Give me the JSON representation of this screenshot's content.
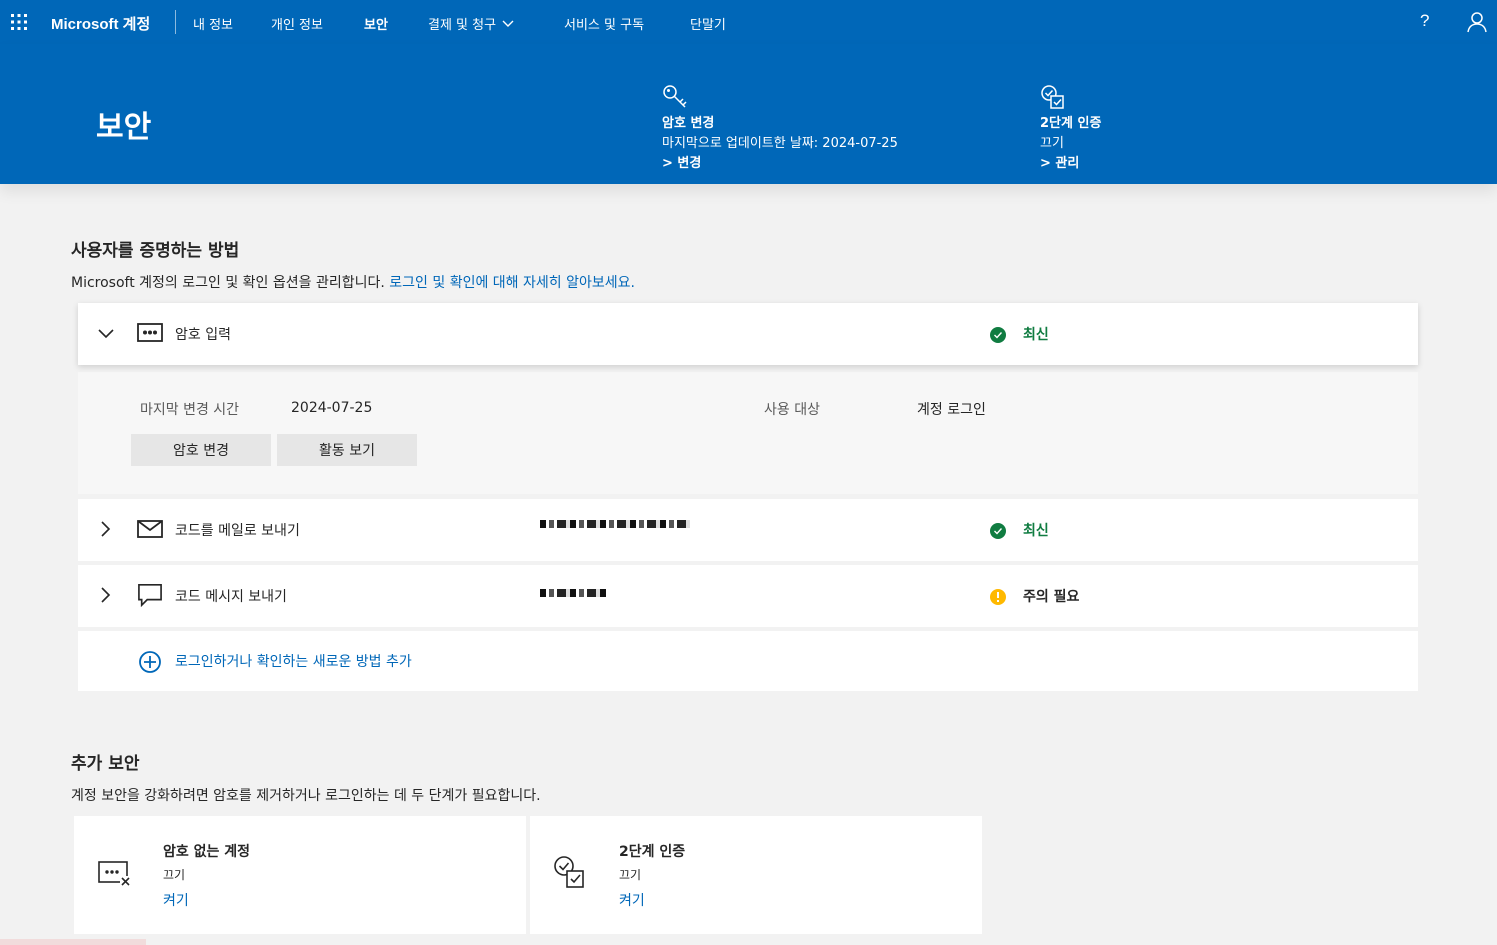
{
  "nav": {
    "brand": "Microsoft 계정",
    "items": [
      {
        "label": "내 정보"
      },
      {
        "label": "개인 정보"
      },
      {
        "label": "보안"
      },
      {
        "label": "결제 및 청구"
      },
      {
        "label": "서비스 및 구독"
      },
      {
        "label": "단말기"
      }
    ],
    "help_glyph": "?"
  },
  "hero": {
    "title": "보안",
    "password_card": {
      "title": "암호 변경",
      "subtitle": "마지막으로 업데이트한 날짜: 2024-07-25",
      "link": "> 변경"
    },
    "twofa_card": {
      "title": "2단계 인증",
      "subtitle": "끄기",
      "link": "> 관리"
    }
  },
  "proof": {
    "title": "사용자를 증명하는 방법",
    "desc": "Microsoft 계정의 로그인 및 확인 옵션을 관리합니다.",
    "desc_link": "로그인 및 확인에 대해 자세히 알아보세요.",
    "methods": [
      {
        "label": "암호 입력",
        "status": "최신"
      },
      {
        "label": "코드를 메일로 보내기",
        "status": "최신"
      },
      {
        "label": "코드 메시지 보내기",
        "status": "주의 필요"
      }
    ],
    "details": {
      "last_changed_label": "마지막 변경 시간",
      "last_changed_value": "2024-07-25",
      "used_for_label": "사용 대상",
      "used_for_value": "계정 로그인",
      "change_button": "암호 변경",
      "activity_button": "활동 보기"
    },
    "add_method": "로그인하거나 확인하는 새로운 방법 추가"
  },
  "extra": {
    "title": "추가 보안",
    "desc": "계정 보안을 강화하려면 암호를 제거하거나 로그인하는 데 두 단계가 필요합니다.",
    "cards": [
      {
        "title": "암호 없는 계정",
        "subtitle": "끄기",
        "link": "켜기"
      },
      {
        "title": "2단계 인증",
        "subtitle": "끄기",
        "link": "켜기"
      }
    ]
  },
  "colors": {
    "brand_blue": "#0067b8",
    "ok_green": "#107c41",
    "warn_yellow": "#ffb900"
  }
}
